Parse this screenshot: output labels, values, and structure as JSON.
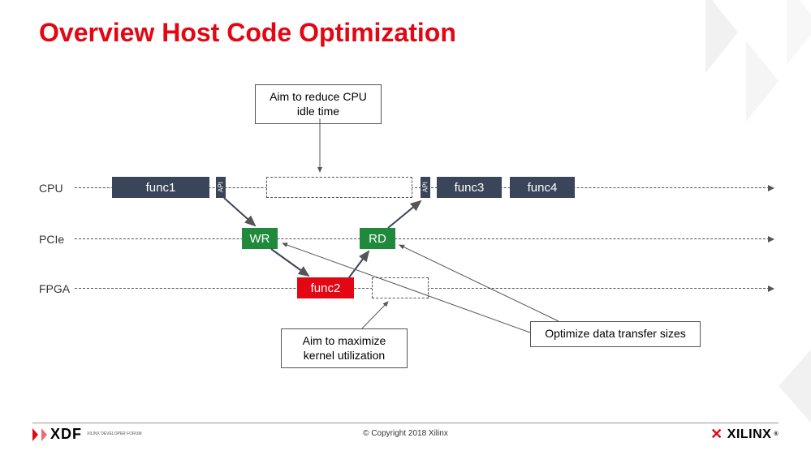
{
  "title": "Overview Host Code Optimization",
  "rows": {
    "cpu": "CPU",
    "pcie": "PCIe",
    "fpga": "FPGA"
  },
  "blocks": {
    "func1": "func1",
    "api1": "API",
    "api2": "API",
    "func3": "func3",
    "func4": "func4",
    "wr": "WR",
    "rd": "RD",
    "func2": "func2"
  },
  "callouts": {
    "reduce_idle": "Aim to reduce CPU idle time",
    "maximize_kernel": "Aim to maximize kernel utilization",
    "optimize_transfer": "Optimize data transfer sizes"
  },
  "footer": {
    "copyright": "© Copyright 2018 Xilinx",
    "xdf_sub": "XILINX DEVELOPER FORUM",
    "xdf": "XDF",
    "xilinx": "XILINX"
  }
}
